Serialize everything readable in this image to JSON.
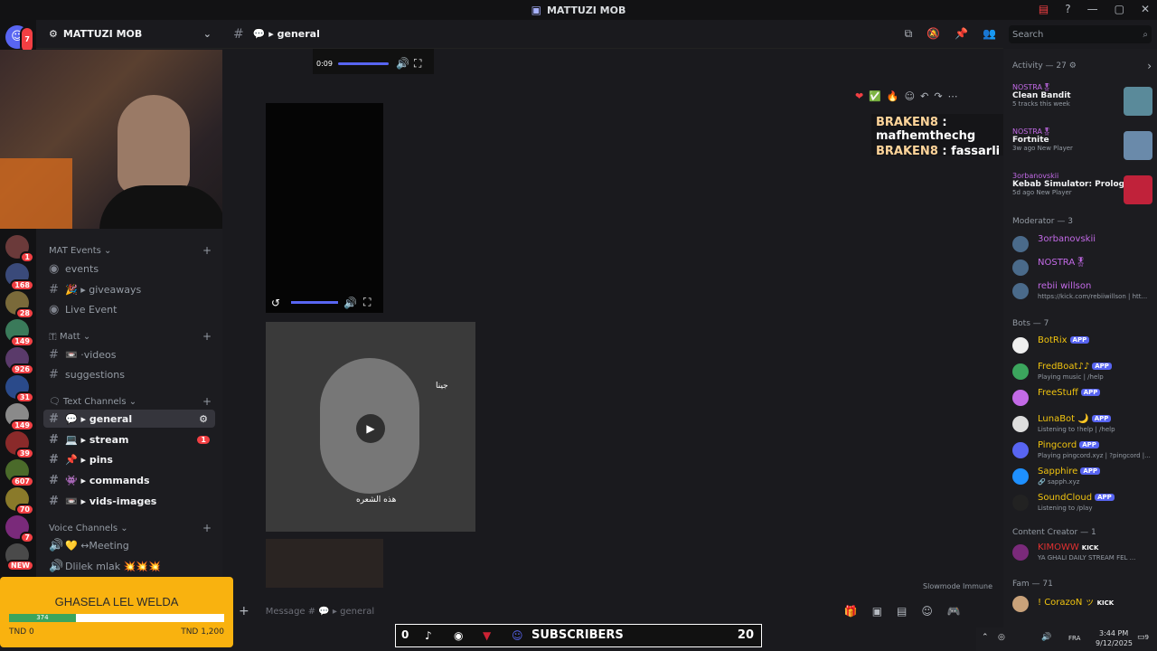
{
  "window": {
    "title": "MATTUZI MOB"
  },
  "server": {
    "name": "MATTUZI MOB",
    "dm_badge": "7"
  },
  "servers": [
    {
      "badge": "1",
      "color": "#6b3a3a"
    },
    {
      "badge": "168",
      "color": "#3a4a7a"
    },
    {
      "badge": "28",
      "color": "#7a6a3a"
    },
    {
      "badge": "149",
      "color": "#3a7a5a"
    },
    {
      "badge": "926",
      "color": "#5a3a6a"
    },
    {
      "badge": "31",
      "color": "#2a4a8a"
    },
    {
      "badge": "149",
      "color": "#8a8a8a"
    },
    {
      "badge": "39",
      "color": "#8a2a2a"
    },
    {
      "badge": "607",
      "color": "#4a6a2a"
    },
    {
      "badge": "70",
      "color": "#8a7a2a"
    },
    {
      "badge": "7",
      "color": "#7a2a7a"
    },
    {
      "badge": "NEW",
      "color": "#4a4a4a"
    }
  ],
  "channels": {
    "cat1": "MAT Events",
    "events": "events",
    "giveaways": "🎉 ▸ giveaways",
    "live_event": "Live Event",
    "cat2": "🇹 Matt",
    "videos": "📼 ·videos",
    "suggestions": "suggestions",
    "cat3": "🗨 Text Channels",
    "general": "💬 ▸ general",
    "stream": "💻 ▸ stream",
    "stream_badge": "1",
    "pins": "📌 ▸ pins",
    "commands": "👾 ▸ commands",
    "vids_images": "📼 ▸ vids-images",
    "cat4": "Voice Channels",
    "meeting": "💛 ↔Meeting",
    "dlilek": "Dlilek mlak 💥💥💥"
  },
  "header": {
    "channel": "💬 ▸ general",
    "search_placeholder": "Search"
  },
  "media": {
    "time": "0:09",
    "slowmode": "Slowmode Immune",
    "video_caption": "هذه الشعره",
    "video_side": "جينا"
  },
  "overlay_chat": [
    {
      "user": "BRAKEN8",
      "msg": "mafhemthechg"
    },
    {
      "user": "BRAKEN8",
      "msg": "fassarli"
    }
  ],
  "composer": {
    "placeholder": "Message # 💬 ▸ general"
  },
  "right": {
    "activity_title": "Activity — 27",
    "activities": [
      {
        "who": "NOSTRA🎖",
        "game": "Clean Bandit",
        "meta": "5 tracks this week"
      },
      {
        "who": "NOSTRA🎖",
        "game": "Fortnite",
        "meta": "3w ago",
        "tag": "New Player"
      },
      {
        "who": "3orbanovskii",
        "game": "Kebab Simulator: Prologue",
        "meta": "5d ago",
        "tag": "New Player"
      }
    ],
    "moderator_title": "Moderator — 3",
    "moderators": [
      {
        "name": "3orbanovskii",
        "color": "#c36ae7"
      },
      {
        "name": "NOSTRA🎖",
        "color": "#c36ae7"
      },
      {
        "name": "rebii willson",
        "color": "#c36ae7",
        "sub": "https://kick.com/rebiiwillson | htt..."
      }
    ],
    "bots_title": "Bots — 7",
    "bots": [
      {
        "name": "BotRix",
        "tag": "APP",
        "sub": ""
      },
      {
        "name": "FredBoat♪♪",
        "tag": "APP",
        "sub": "Playing music | /help"
      },
      {
        "name": "FreeStuff",
        "tag": "APP",
        "sub": ""
      },
      {
        "name": "LunaBot 🌙",
        "tag": "APP",
        "sub": "Listening to !help | /help"
      },
      {
        "name": "Pingcord",
        "tag": "APP",
        "sub": "Playing pingcord.xyz | ?pingcord |..."
      },
      {
        "name": "Sapphire",
        "tag": "APP",
        "sub": "🔗 sapph.xyz"
      },
      {
        "name": "SoundCloud",
        "tag": "APP",
        "sub": "Listening to /play"
      }
    ],
    "creator_title": "Content Creator — 1",
    "creator": {
      "name": "KIMOWW",
      "tag": "KICK",
      "sub": "YA GHALI DAILY STREAM FEL ..."
    },
    "fam_title": "Fam — 71",
    "fam": {
      "name": "! CorazoN ッ",
      "tag": "KICK"
    }
  },
  "donation": {
    "title": "GHASELA LEL WELDA",
    "current": "374",
    "left": "TND 0",
    "right": "TND 1,200",
    "progress": 0.31
  },
  "subscribers": {
    "left": "0",
    "label": "SUBSCRIBERS",
    "count": "20"
  },
  "taskbar": {
    "lang": "FRA",
    "time": "3:44 PM",
    "date": "9/12/2025",
    "notif": "9"
  }
}
